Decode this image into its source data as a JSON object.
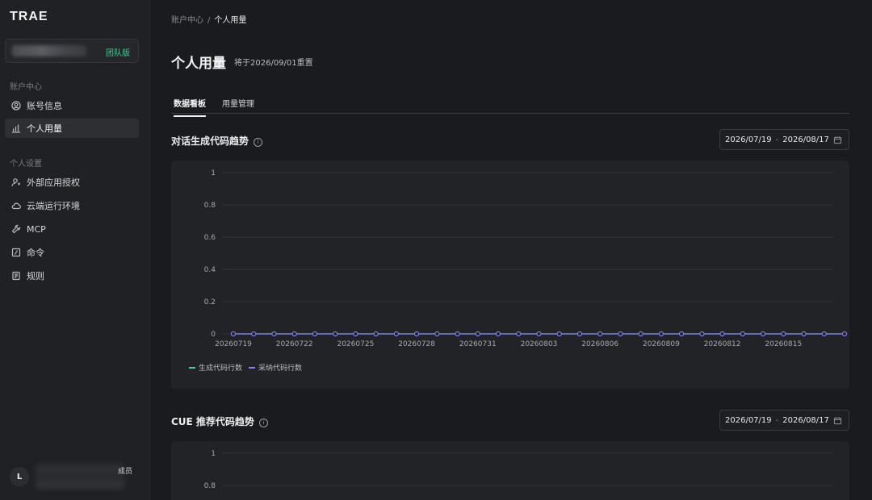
{
  "app": {
    "logo": "TRAE"
  },
  "sidebar": {
    "team_badge": "团队版",
    "section1": "账户中心",
    "section2": "个人设置",
    "items": [
      {
        "label": "账号信息",
        "icon": "user-circle-icon"
      },
      {
        "label": "个人用量",
        "icon": "bar-chart-icon"
      },
      {
        "label": "外部应用授权",
        "icon": "user-key-icon"
      },
      {
        "label": "云端运行环境",
        "icon": "cloud-icon"
      },
      {
        "label": "MCP",
        "icon": "wrench-icon"
      },
      {
        "label": "命令",
        "icon": "slash-command-icon"
      },
      {
        "label": "规则",
        "icon": "rules-doc-icon"
      }
    ],
    "user": {
      "initial": "L",
      "role": "成员"
    }
  },
  "breadcrumb": {
    "parent": "账户中心",
    "separator": "/",
    "current": "个人用量"
  },
  "page": {
    "title": "个人用量",
    "reset_note": "将于2026/09/01重置"
  },
  "tabs": [
    {
      "label": "数据看板",
      "active": true
    },
    {
      "label": "用量管理",
      "active": false
    }
  ],
  "cards": [
    {
      "title": "对话生成代码趋势",
      "date_start": "2026/07/19",
      "date_end": "2026/08/17"
    },
    {
      "title": "CUE 推荐代码趋势",
      "date_start": "2026/07/19",
      "date_end": "2026/08/17"
    }
  ],
  "colors": {
    "accent_green": "#3ed192",
    "series1": "#3ed192",
    "series2": "#8b7cf6"
  },
  "chart_data": [
    {
      "type": "line",
      "title": "对话生成代码趋势",
      "x": [
        "20260719",
        "20260720",
        "20260721",
        "20260722",
        "20260723",
        "20260724",
        "20260725",
        "20260726",
        "20260727",
        "20260728",
        "20260729",
        "20260730",
        "20260731",
        "20260801",
        "20260802",
        "20260803",
        "20260804",
        "20260805",
        "20260806",
        "20260807",
        "20260808",
        "20260809",
        "20260810",
        "20260811",
        "20260812",
        "20260813",
        "20260814",
        "20260815",
        "20260816",
        "20260817",
        "20260818"
      ],
      "x_tick_labels": [
        "20260719",
        "20260722",
        "20260725",
        "20260728",
        "20260731",
        "20260803",
        "20260806",
        "20260809",
        "20260812",
        "20260815"
      ],
      "y_ticks": [
        "1",
        "0.8",
        "0.6",
        "0.4",
        "0.2",
        "0"
      ],
      "ylim": [
        0,
        1
      ],
      "series": [
        {
          "name": "生成代码行数",
          "values": [
            0,
            0,
            0,
            0,
            0,
            0,
            0,
            0,
            0,
            0,
            0,
            0,
            0,
            0,
            0,
            0,
            0,
            0,
            0,
            0,
            0,
            0,
            0,
            0,
            0,
            0,
            0,
            0,
            0,
            0,
            0
          ]
        },
        {
          "name": "采纳代码行数",
          "values": [
            0,
            0,
            0,
            0,
            0,
            0,
            0,
            0,
            0,
            0,
            0,
            0,
            0,
            0,
            0,
            0,
            0,
            0,
            0,
            0,
            0,
            0,
            0,
            0,
            0,
            0,
            0,
            0,
            0,
            0,
            0
          ]
        }
      ],
      "grid": true,
      "legend": "bottom-left"
    },
    {
      "type": "line",
      "title": "CUE 推荐代码趋势",
      "y_ticks": [
        "1",
        "0.8"
      ],
      "ylim": [
        0,
        1
      ],
      "grid": true
    }
  ]
}
